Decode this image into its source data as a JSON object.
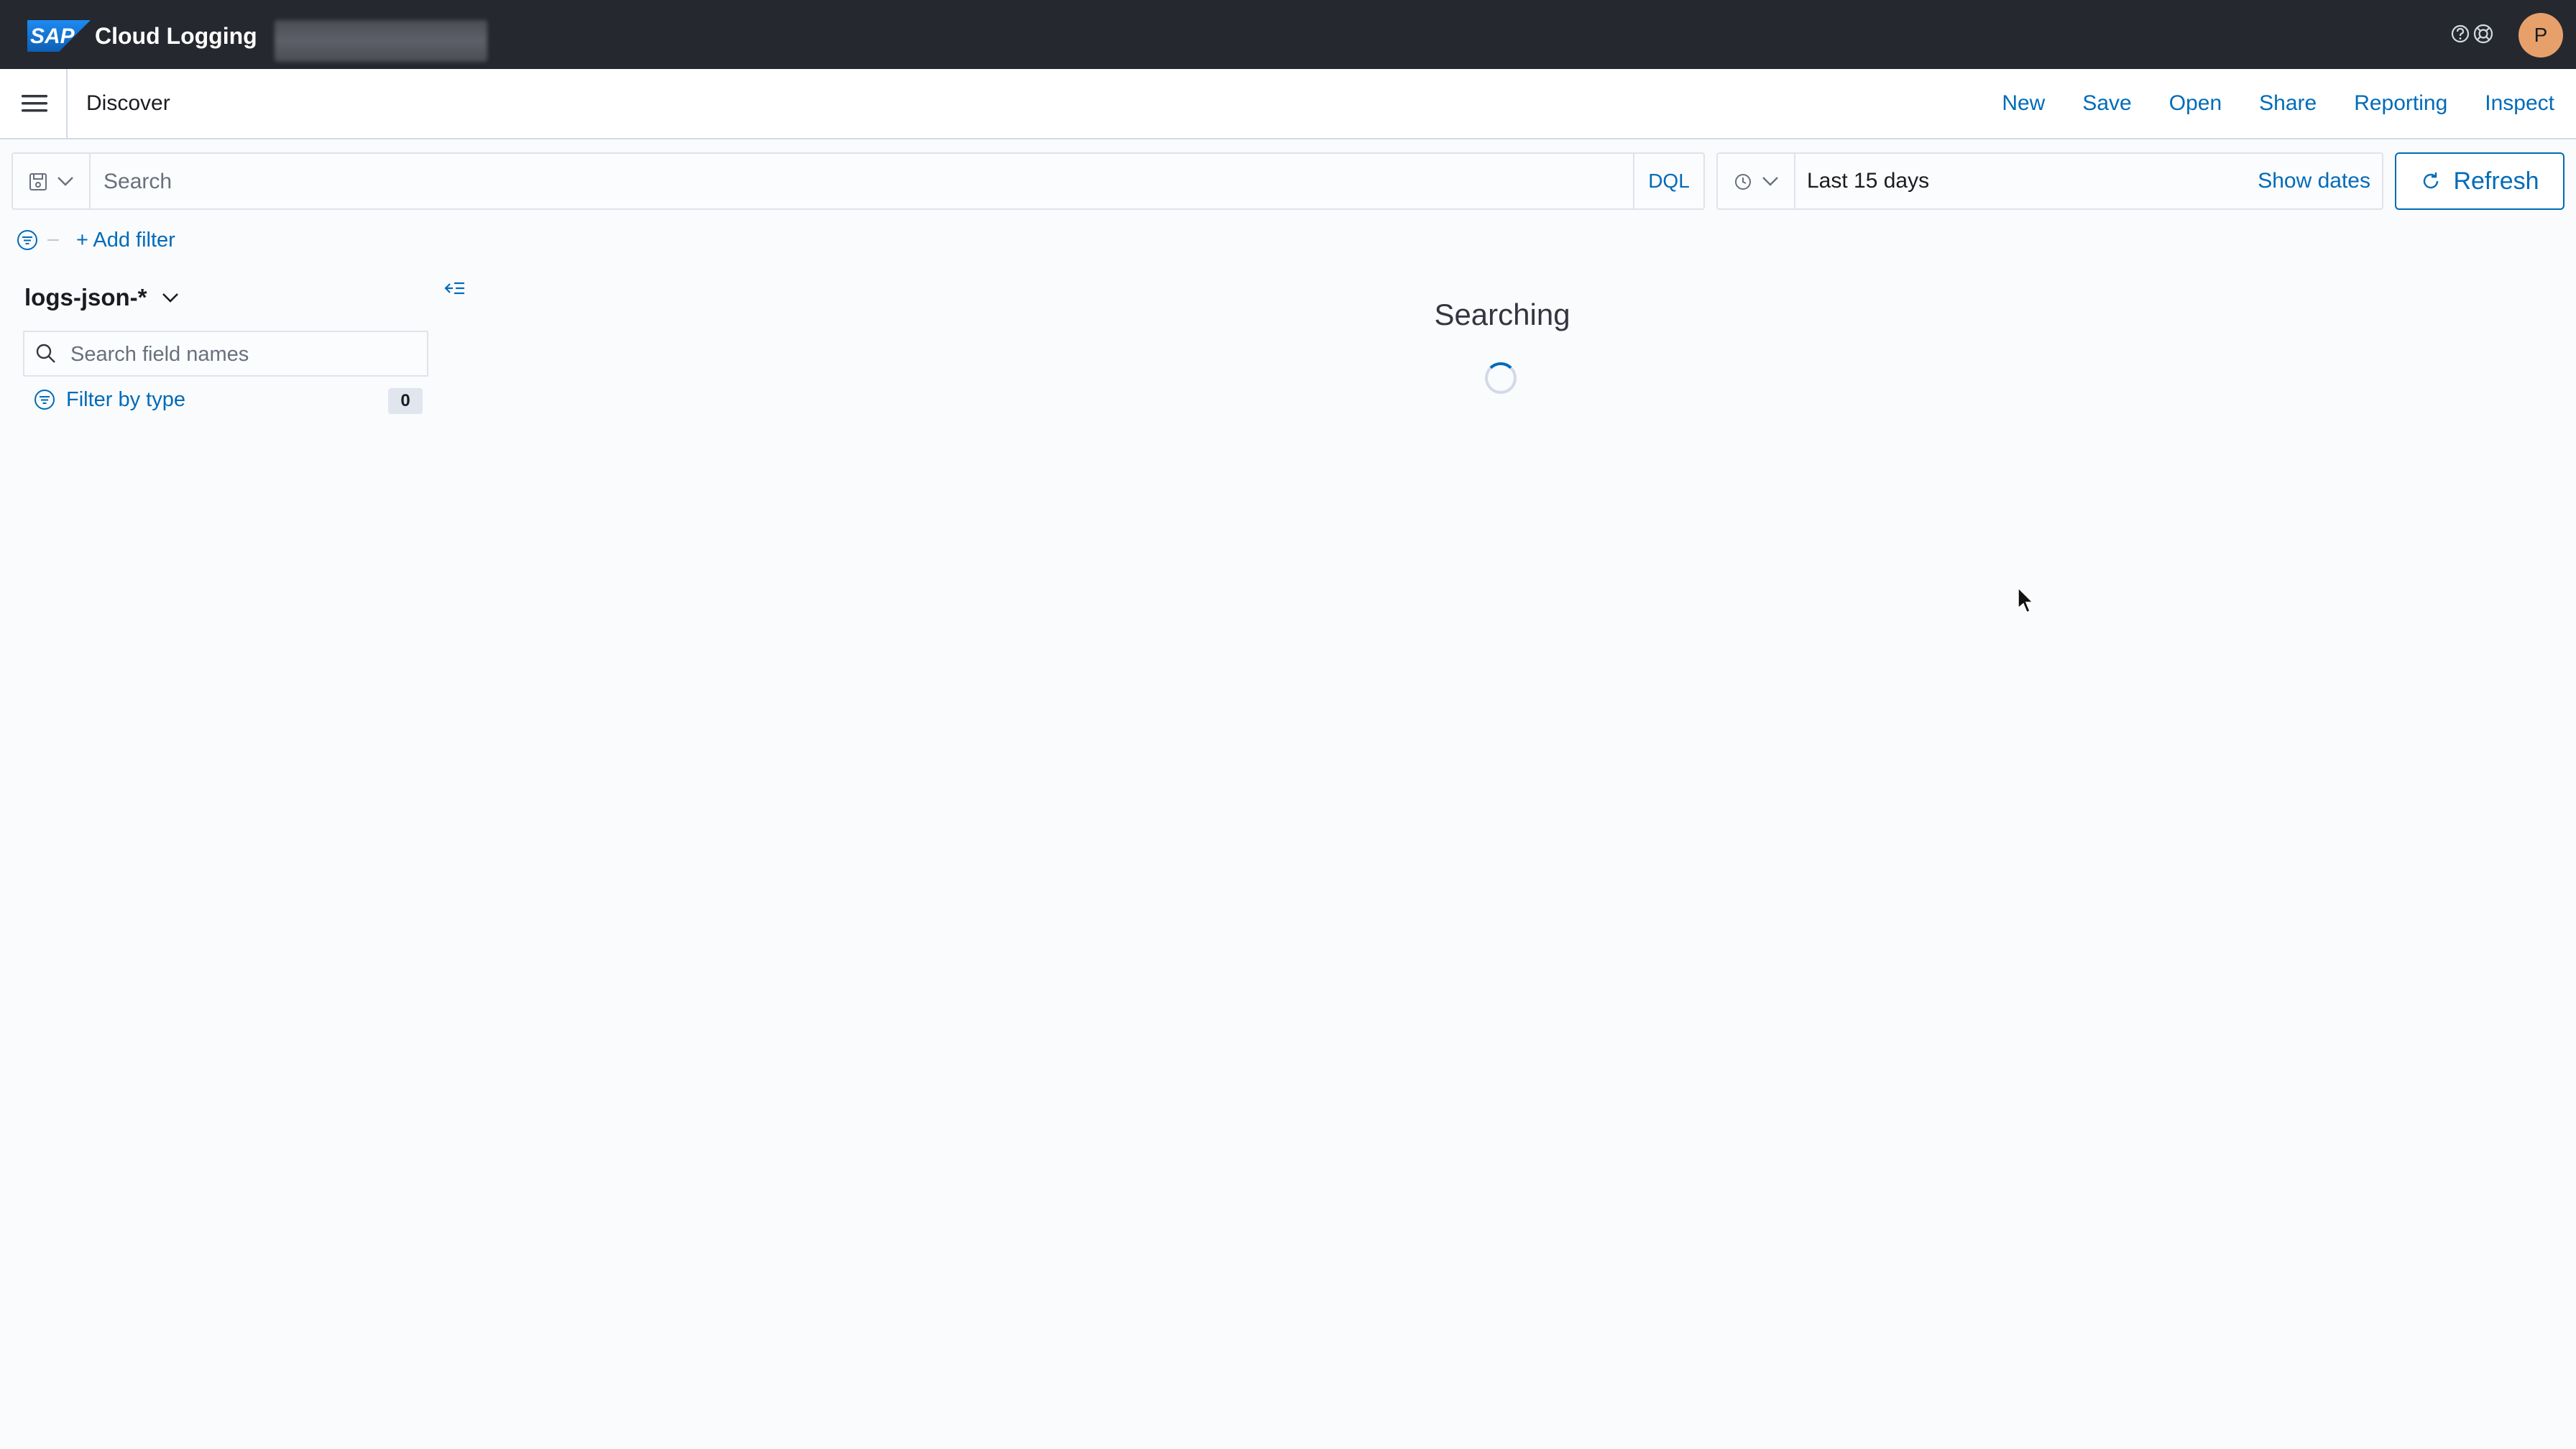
{
  "header": {
    "brand_logo": "SAP",
    "product_name": "Cloud Logging",
    "avatar_initial": "P",
    "icons": [
      "help-icon",
      "support-icon"
    ],
    "colors": {
      "header_bg": "#25282f",
      "sap_blue": "#1a73c8",
      "avatar_bg": "#e7a06a"
    }
  },
  "subbar": {
    "page_title": "Discover",
    "nav": [
      "New",
      "Save",
      "Open",
      "Share",
      "Reporting",
      "Inspect"
    ]
  },
  "query": {
    "search_placeholder": "Search",
    "language": "DQL",
    "date_range": "Last 15 days",
    "show_dates": "Show dates",
    "refresh_label": "Refresh"
  },
  "filters": {
    "add_filter": "+ Add filter"
  },
  "sidebar": {
    "index_pattern": "logs-json-*",
    "field_search_placeholder": "Search field names",
    "filter_by_type": "Filter by type",
    "type_count": "0"
  },
  "main": {
    "status": "Searching"
  },
  "theme": {
    "link_color": "#006bb8",
    "background": "#fafbfd"
  }
}
